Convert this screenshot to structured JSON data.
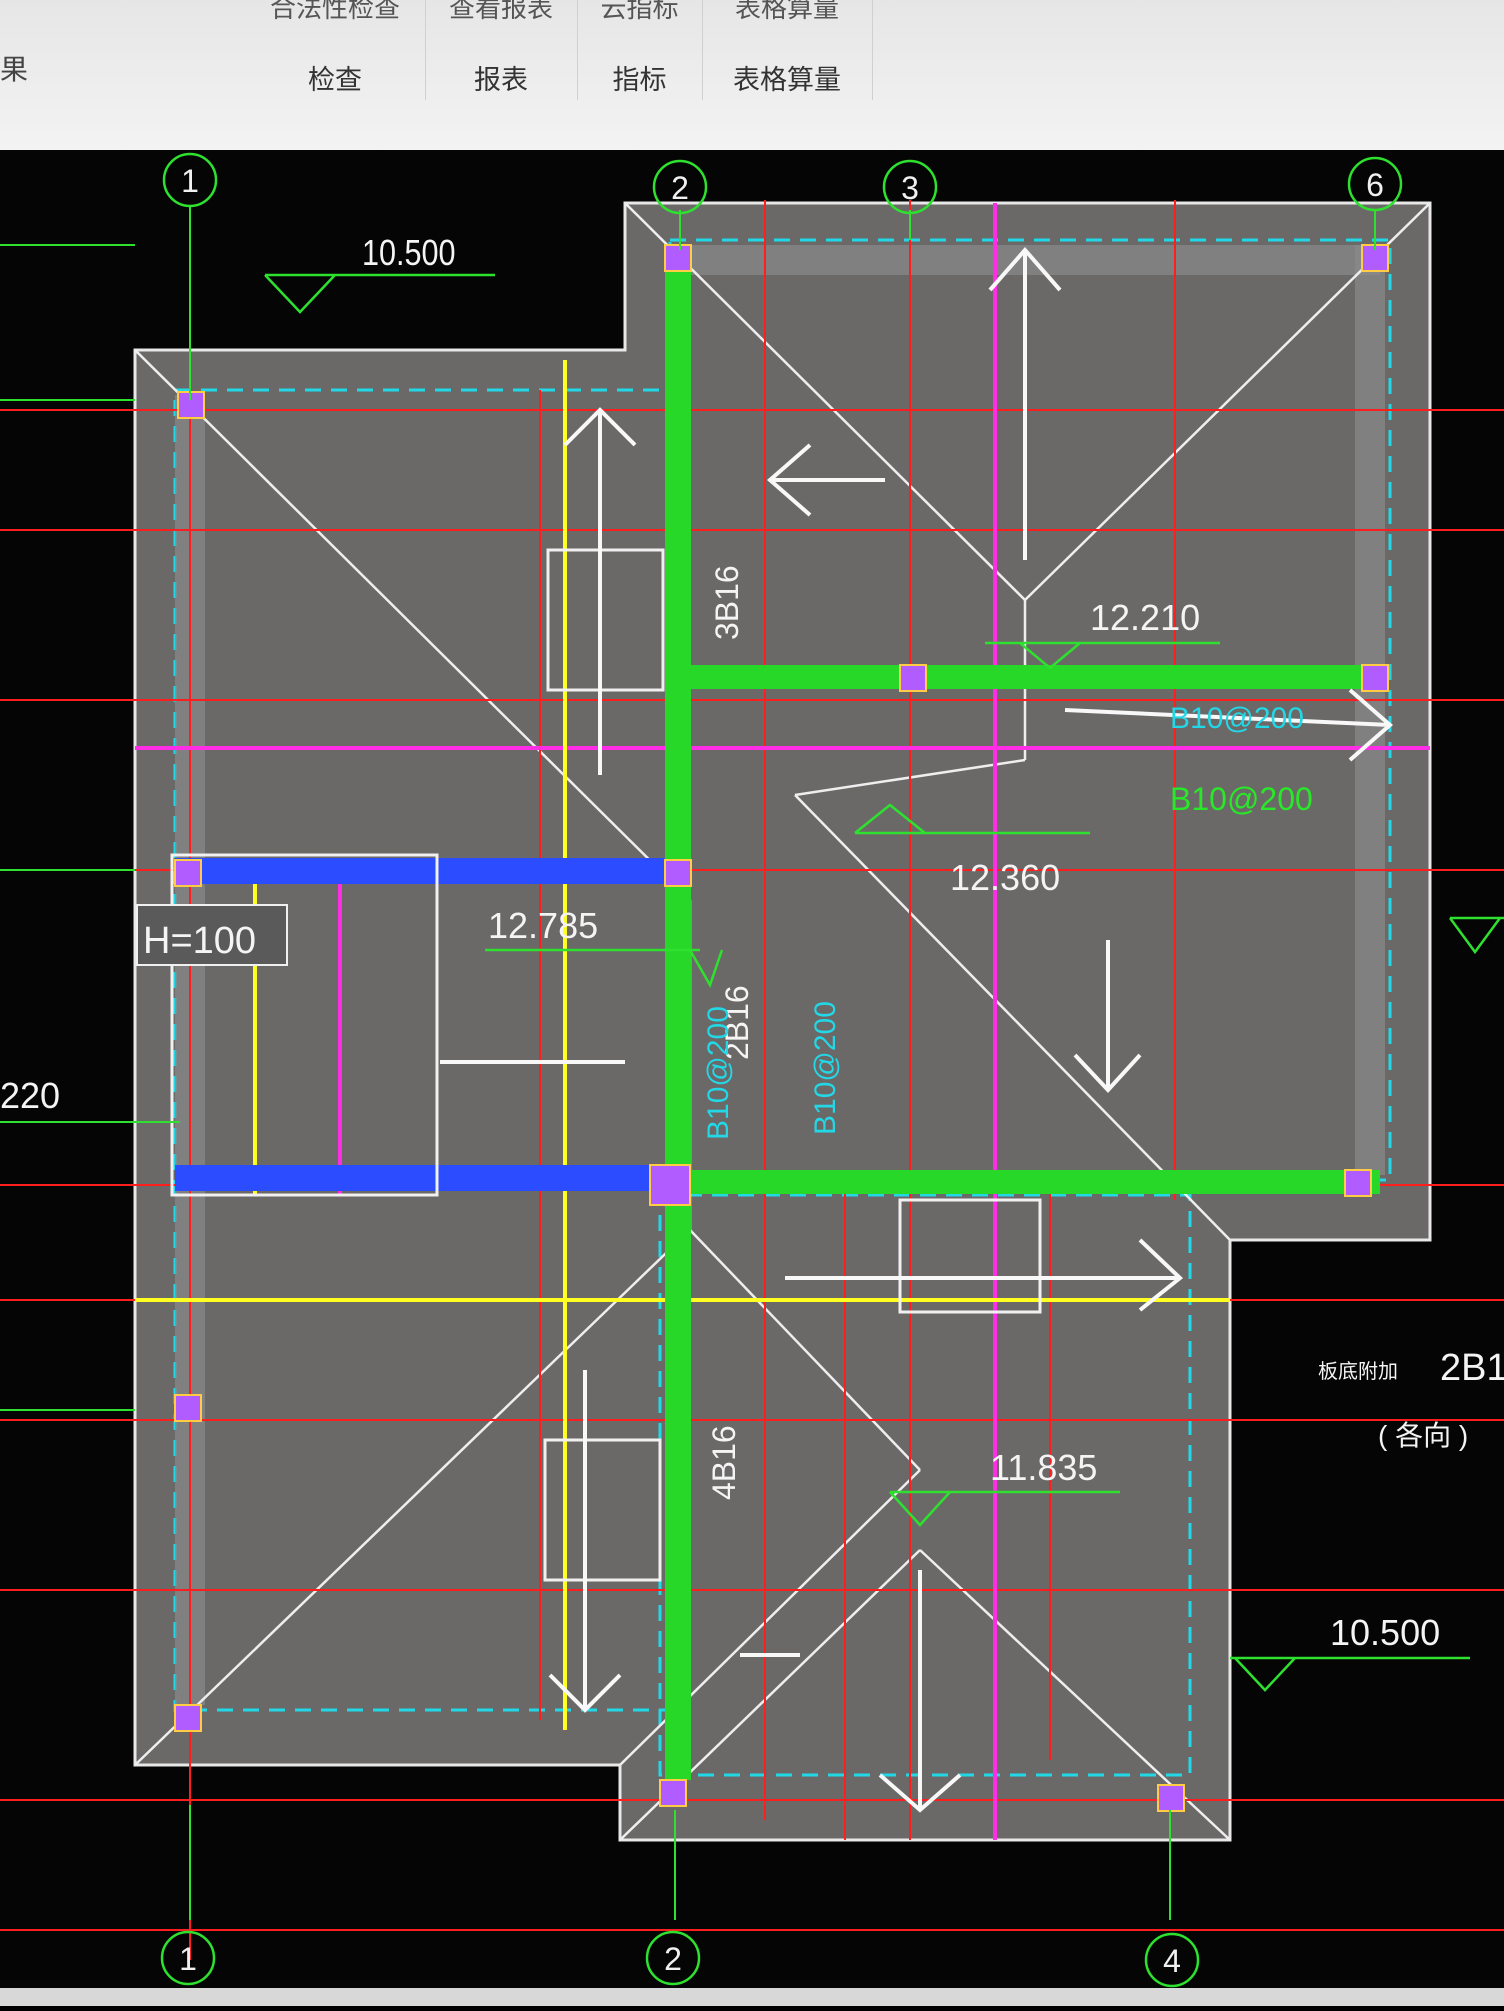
{
  "ribbon": {
    "left_label": "果",
    "groups": [
      {
        "top": "合法性检查",
        "label": "检查"
      },
      {
        "top": "查看报表",
        "label": "报表"
      },
      {
        "top": "云指标",
        "label": "指标"
      },
      {
        "top": "表格算量",
        "label": "表格算量"
      }
    ]
  },
  "drawing": {
    "axes_top": [
      "1",
      "2",
      "3",
      "6"
    ],
    "axes_bottom": [
      "1",
      "2",
      "4"
    ],
    "elevations": {
      "top_left": "10.500",
      "right_upper": "12.210",
      "middle": "12.360",
      "left_middle": "12.785",
      "lower": "11.835",
      "bottom_right": "10.500",
      "left_edge": "220"
    },
    "rebar_labels": {
      "beam_top": "3B16",
      "beam_mid": "2B16",
      "beam_bottom": "4B16",
      "slab_1": "B10@200",
      "slab_2": "B10@200",
      "slab_3": "B10@200",
      "slab_4": "B10@200"
    },
    "hatch_label": "H=100",
    "side_note": {
      "line1_prefix": "板底附加",
      "line1_value": "2B1",
      "line2": "(   各向   )"
    },
    "colors": {
      "background": "#050505",
      "roof_fill": "#6b6868",
      "grid_red": "#ff1e1e",
      "beam_green": "#28d828",
      "cyan": "#22d7e6",
      "magenta": "#ff2ee6",
      "yellow": "#ffff22",
      "column_purple": "#b05cff",
      "axis_green": "#2ee12e"
    }
  }
}
